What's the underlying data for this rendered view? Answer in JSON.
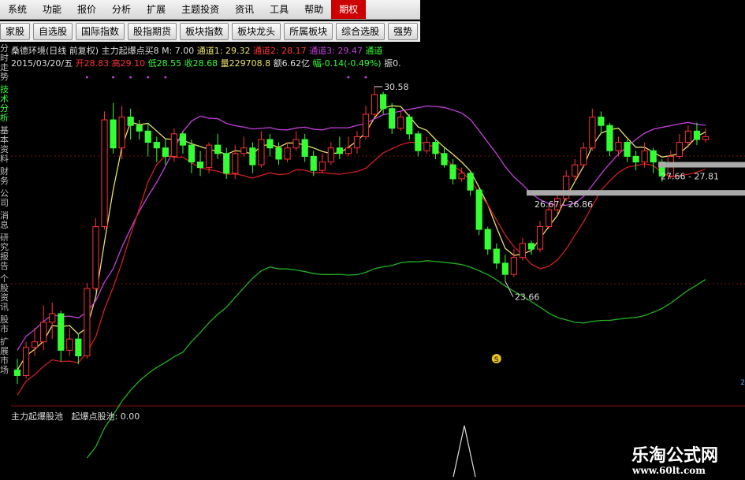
{
  "menu": [
    "系统",
    "功能",
    "报价",
    "分析",
    "扩展",
    "主题投资",
    "资讯",
    "工具",
    "帮助",
    "期权"
  ],
  "menu_active": 9,
  "toolbar": [
    "家股",
    "自选股",
    "国际指数",
    "股指期货",
    "板块指数",
    "板块龙头",
    "所属板块",
    "综合选股",
    "强势"
  ],
  "left_tabs": [
    "分时走势",
    "技术分析",
    "基本资料",
    "财务",
    "公司",
    "消息",
    "研究报告",
    "个股资讯",
    "股市",
    "扩展市场"
  ],
  "info": {
    "name": "桑德环境(日线 前复权)",
    "indicator": "主力起爆点买8",
    "m": "M: 7.00",
    "ch1": "通道1: 29.32",
    "ch2": "通道2: 28.17",
    "ch3": "通道3: 29.47",
    "ch4": "通道",
    "date": "2015/03/20/五",
    "open": "开28.83",
    "high": "高29.10",
    "low": "低28.55",
    "close": "收28.68",
    "vol": "量229708.8",
    "amt": "额6.62亿",
    "chg": "幅-0.14(-0.49%)",
    "amp": "振0."
  },
  "annotations": {
    "high": "30.58",
    "low": "23.66",
    "zone1": "27.66 - 27.81",
    "zone2": "26.67 - 26.86",
    "badge": "S"
  },
  "sub_pane": {
    "title": "主力起爆股池",
    "value": "起爆点股池: 0.00"
  },
  "watermark": {
    "title": "乐淘公式网",
    "url": "www.60lt.com"
  },
  "right_label": "2",
  "colors": {
    "up": "#ff3333",
    "down": "#33ff33",
    "ma_yellow": "#e8e06a",
    "ma_purple": "#c040d8",
    "ma_red": "#d02020",
    "ma_green": "#20b020",
    "menu_active": "#cc0000",
    "zone": "#aaaaaa"
  },
  "chart_data": {
    "type": "candlestick",
    "candles": [
      [
        20.5,
        20.3,
        20.9,
        20.0
      ],
      [
        20.3,
        21.3,
        21.5,
        20.2
      ],
      [
        21.3,
        21.5,
        22.0,
        21.0
      ],
      [
        21.5,
        22.2,
        22.8,
        21.2
      ],
      [
        22.2,
        22.5,
        22.9,
        21.6
      ],
      [
        22.5,
        21.2,
        22.6,
        20.8
      ],
      [
        21.2,
        21.6,
        22.0,
        21.0
      ],
      [
        21.6,
        21.0,
        21.8,
        20.7
      ],
      [
        21.0,
        23.4,
        23.6,
        20.9
      ],
      [
        23.4,
        25.6,
        25.9,
        23.3
      ],
      [
        25.6,
        29.4,
        29.7,
        25.5
      ],
      [
        29.4,
        28.4,
        30.0,
        28.2
      ],
      [
        28.4,
        29.5,
        29.9,
        28.0
      ],
      [
        29.5,
        29.2,
        29.8,
        28.7
      ],
      [
        29.2,
        29.0,
        29.4,
        28.7
      ],
      [
        29.0,
        28.6,
        29.3,
        28.1
      ],
      [
        28.6,
        28.4,
        28.8,
        27.9
      ],
      [
        28.4,
        28.1,
        28.7,
        27.8
      ],
      [
        28.1,
        28.9,
        29.1,
        27.9
      ],
      [
        28.9,
        28.5,
        29.0,
        28.2
      ],
      [
        28.5,
        27.9,
        28.7,
        27.5
      ],
      [
        27.9,
        27.7,
        28.3,
        27.4
      ],
      [
        27.7,
        28.5,
        28.6,
        27.5
      ],
      [
        28.5,
        28.2,
        28.9,
        28.0
      ],
      [
        28.2,
        27.5,
        28.4,
        27.3
      ],
      [
        27.5,
        28.2,
        28.5,
        27.3
      ],
      [
        28.2,
        28.4,
        28.8,
        28.1
      ],
      [
        28.4,
        27.8,
        28.6,
        27.5
      ],
      [
        27.8,
        28.7,
        29.0,
        27.7
      ],
      [
        28.7,
        28.4,
        28.9,
        28.1
      ],
      [
        28.4,
        28.0,
        28.6,
        27.8
      ],
      [
        28.0,
        28.4,
        28.6,
        27.9
      ],
      [
        28.4,
        28.7,
        29.0,
        28.3
      ],
      [
        28.7,
        28.1,
        28.9,
        27.9
      ],
      [
        28.1,
        27.6,
        28.3,
        27.4
      ],
      [
        27.6,
        27.9,
        28.2,
        27.5
      ],
      [
        27.9,
        28.4,
        28.6,
        27.8
      ],
      [
        28.4,
        28.2,
        28.8,
        28.0
      ],
      [
        28.2,
        28.4,
        28.8,
        28.1
      ],
      [
        28.4,
        28.8,
        29.0,
        28.2
      ],
      [
        28.8,
        29.6,
        29.9,
        28.7
      ],
      [
        29.6,
        30.3,
        30.6,
        29.5
      ],
      [
        30.3,
        29.8,
        30.4,
        29.6
      ],
      [
        29.8,
        29.1,
        30.0,
        28.9
      ],
      [
        29.1,
        29.5,
        29.7,
        29.0
      ],
      [
        29.5,
        28.9,
        29.6,
        28.7
      ],
      [
        28.9,
        28.3,
        29.0,
        28.1
      ],
      [
        28.3,
        28.6,
        28.8,
        28.2
      ],
      [
        28.6,
        28.2,
        28.7,
        28.0
      ],
      [
        28.2,
        27.8,
        28.4,
        27.7
      ],
      [
        27.8,
        27.3,
        28.0,
        27.1
      ],
      [
        27.3,
        27.5,
        27.7,
        27.2
      ],
      [
        27.5,
        26.9,
        27.6,
        26.7
      ],
      [
        26.9,
        25.5,
        27.0,
        25.3
      ],
      [
        25.5,
        24.8,
        25.6,
        24.6
      ],
      [
        24.8,
        24.3,
        25.0,
        24.1
      ],
      [
        24.3,
        23.9,
        24.6,
        23.66
      ],
      [
        23.9,
        24.5,
        24.8,
        23.8
      ],
      [
        24.5,
        25.0,
        25.2,
        24.4
      ],
      [
        25.0,
        24.8,
        25.1,
        24.6
      ],
      [
        24.8,
        25.6,
        25.8,
        24.7
      ],
      [
        25.6,
        26.2,
        26.4,
        25.5
      ],
      [
        26.2,
        26.6,
        26.8,
        26.0
      ],
      [
        26.6,
        27.4,
        27.6,
        26.5
      ],
      [
        27.4,
        27.8,
        28.0,
        27.2
      ],
      [
        27.8,
        28.4,
        28.6,
        27.7
      ],
      [
        28.4,
        29.5,
        29.8,
        28.3
      ],
      [
        29.5,
        29.2,
        29.7,
        28.9
      ],
      [
        29.2,
        28.3,
        29.3,
        28.1
      ],
      [
        28.3,
        28.6,
        28.8,
        28.1
      ],
      [
        28.6,
        28.1,
        28.7,
        27.9
      ],
      [
        28.1,
        27.9,
        28.3,
        27.6
      ],
      [
        27.9,
        28.3,
        28.6,
        27.7
      ],
      [
        28.3,
        27.9,
        28.4,
        27.5
      ],
      [
        27.9,
        27.4,
        28.0,
        27.2
      ],
      [
        27.4,
        28.1,
        28.3,
        27.3
      ],
      [
        28.1,
        28.6,
        28.9,
        28.0
      ],
      [
        28.6,
        29.0,
        29.2,
        28.4
      ],
      [
        29.0,
        28.7,
        29.3,
        28.5
      ],
      [
        28.7,
        28.8,
        29.1,
        28.6
      ]
    ]
  }
}
